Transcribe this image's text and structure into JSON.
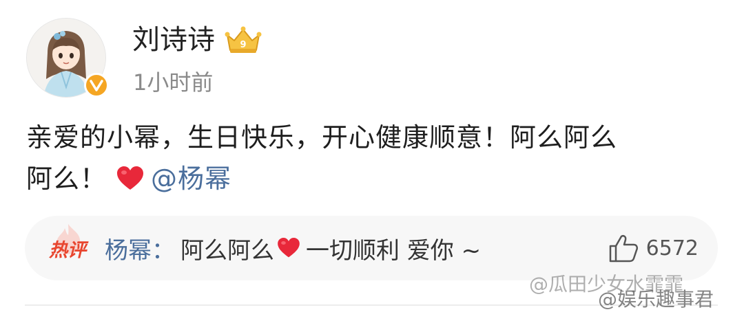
{
  "post": {
    "username": "刘诗诗",
    "time": "1小时前",
    "avatar_icon": "cartoon-girl-avatar",
    "verified_icon": "verified-v-badge",
    "rank_icon": "crown-level-badge",
    "content_line1": "亲爱的小幂，生日快乐，开心健康顺意！阿么阿么",
    "content_line2": "阿么！",
    "mention": "@杨幂",
    "heart_icon": "red-heart-emoji"
  },
  "hot_comment": {
    "tag": "热评",
    "author": "杨幂",
    "separator": "：",
    "text_before_heart": "阿么阿么",
    "text_after_heart": "一切顺利 爱你 ~",
    "like_icon": "thumbs-up-icon",
    "like_count": "6572"
  },
  "watermarks": {
    "line1": "@瓜田少女水霏霏",
    "line2": "@娱乐趣事君"
  },
  "colors": {
    "link": "#4a6e9c",
    "hot_tag": "#e8462f",
    "verified": "#f5a623"
  }
}
